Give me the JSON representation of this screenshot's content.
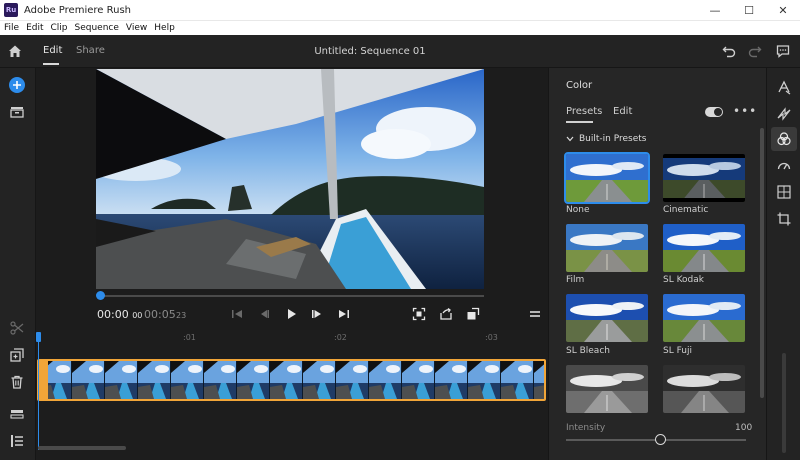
{
  "window": {
    "app_logo": "Ru",
    "title": "Adobe Premiere Rush",
    "controls": {
      "minimize": "—",
      "maximize": "☐",
      "close": "✕"
    }
  },
  "menu": {
    "items": [
      "File",
      "Edit",
      "Clip",
      "Sequence",
      "View",
      "Help"
    ]
  },
  "topnav": {
    "tabs": [
      {
        "label": "Edit",
        "active": true
      },
      {
        "label": "Share",
        "active": false
      }
    ],
    "document_title": "Untitled: Sequence 01"
  },
  "playback": {
    "current_time": "00:00",
    "current_frames": "00",
    "total_time": "00:05",
    "total_frames": "23"
  },
  "timeline": {
    "ruler": [
      ":01",
      ":02",
      ":03"
    ]
  },
  "color_panel": {
    "title": "Color",
    "tabs": [
      {
        "label": "Presets",
        "active": true
      },
      {
        "label": "Edit",
        "active": false
      }
    ],
    "section": "Built-in Presets",
    "presets": [
      {
        "label": "None",
        "selected": true
      },
      {
        "label": "Cinematic",
        "selected": false
      },
      {
        "label": "Film",
        "selected": false
      },
      {
        "label": "SL Kodak",
        "selected": false
      },
      {
        "label": "SL Bleach",
        "selected": false
      },
      {
        "label": "SL Fuji",
        "selected": false
      },
      {
        "label": "",
        "selected": false
      },
      {
        "label": "",
        "selected": false
      }
    ],
    "intensity_label": "Intensity",
    "intensity_value": "100",
    "intensity_level": 0.5
  },
  "colors": {
    "accent": "#2d8ceb",
    "clip_border": "#f1a538"
  },
  "icons": {
    "left_rail": [
      "add-media-icon",
      "media-icon",
      "split-icon",
      "duplicate-icon",
      "delete-icon",
      "tracks-icon",
      "list-icon"
    ],
    "right_rail": [
      "title-icon",
      "transitions-icon",
      "color-icon",
      "speed-icon",
      "audio-icon",
      "transform-icon"
    ]
  }
}
